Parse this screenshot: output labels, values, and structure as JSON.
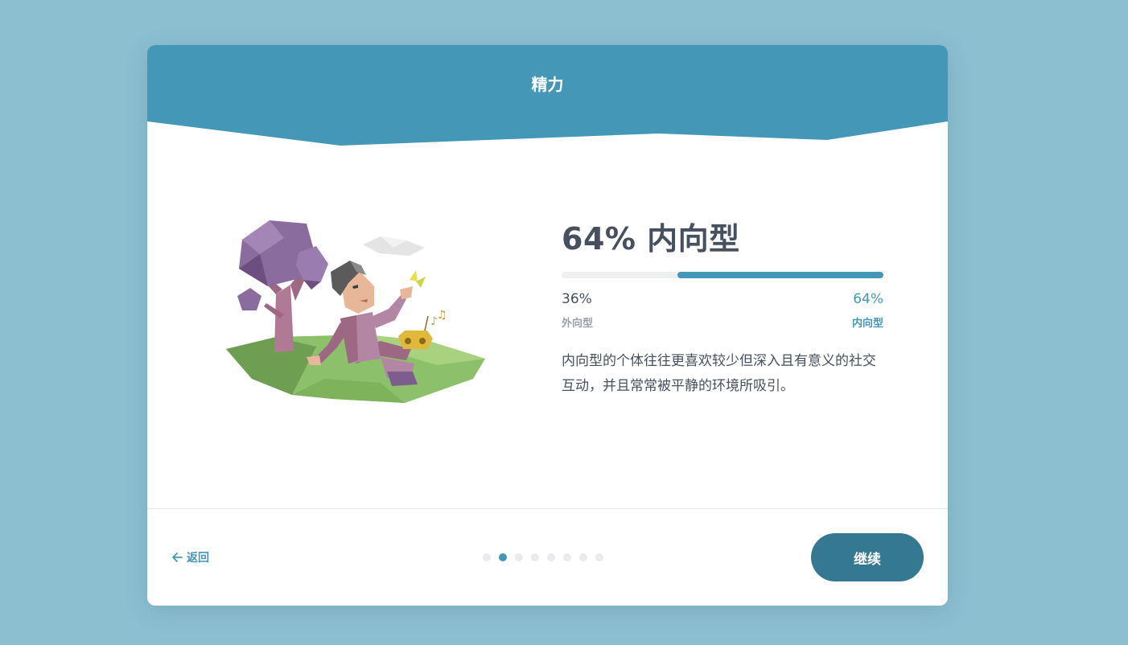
{
  "header": {
    "title": "精力",
    "color": "#4497b6"
  },
  "result": {
    "title": "64% 内向型",
    "introvert_fraction": 0.64,
    "left": {
      "percent": "36%",
      "label": "外向型"
    },
    "right": {
      "percent": "64%",
      "label": "内向型"
    },
    "description": "内向型的个体往往更喜欢较少但深入且有意义的社交互动，并且常常被平静的环境所吸引。"
  },
  "illustration": {
    "icon": "person-under-tree-illustration"
  },
  "footer": {
    "back_label": "返回",
    "back_icon": "arrow-left-icon",
    "continue_label": "继续",
    "pagination": {
      "total": 8,
      "current": 2
    }
  },
  "colors": {
    "background": "#8cbfd0",
    "accent": "#4497b6",
    "button": "#357891",
    "text": "#47505e"
  }
}
